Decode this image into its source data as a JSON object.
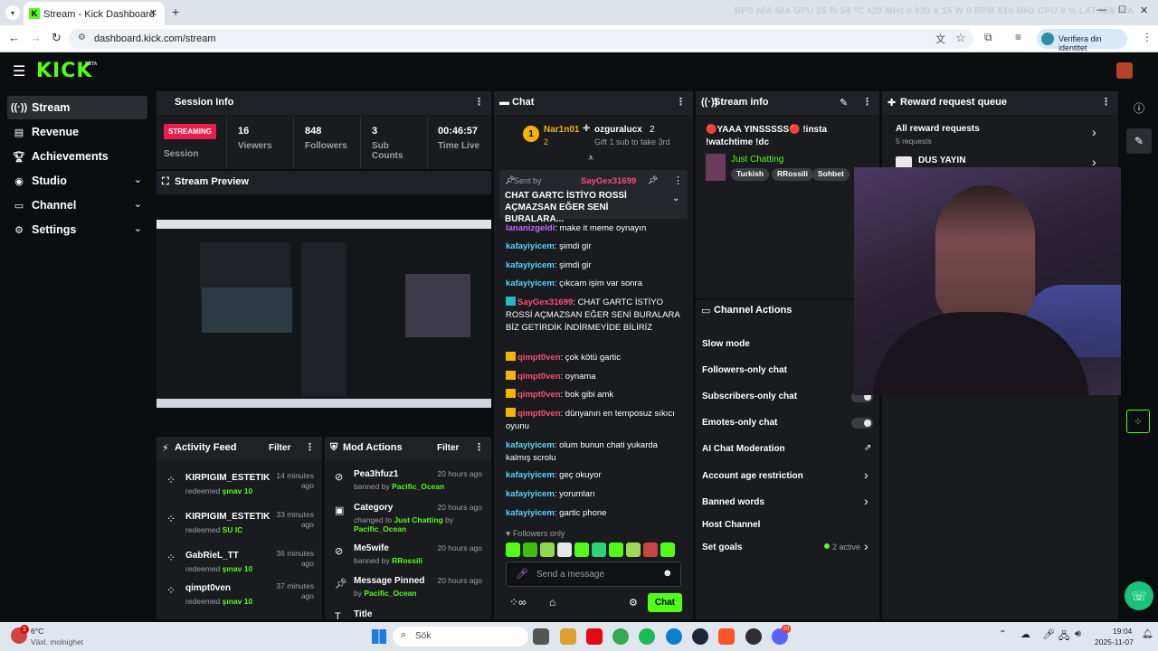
{
  "browser": {
    "tab_title": "Stream - Kick Dashboard",
    "url": "dashboard.kick.com/stream",
    "profile_label": "Verifiera din identitet",
    "hud": "BPS  N/A  N/A     GPU 25 % 54 °C 420 MHz 0.930 V 15 W 0 RPM 810 MHz     CPU 9 %     LAT N/A N/A"
  },
  "kick": {
    "logo": "KICK",
    "beta": "BETA"
  },
  "sidebar": {
    "items": [
      {
        "label": "Stream",
        "active": true
      },
      {
        "label": "Revenue"
      },
      {
        "label": "Achievements"
      },
      {
        "label": "Studio"
      },
      {
        "label": "Channel"
      },
      {
        "label": "Settings"
      }
    ]
  },
  "session": {
    "title": "Session Info",
    "status": "STREAMING",
    "status_label": "Session",
    "stats": [
      {
        "value": "16",
        "label": "Viewers"
      },
      {
        "value": "848",
        "label": "Followers"
      },
      {
        "value": "3",
        "label": "Sub Counts"
      },
      {
        "value": "00:46:57",
        "label": "Time Live"
      }
    ]
  },
  "preview": {
    "title": "Stream Preview"
  },
  "activity": {
    "title": "Activity Feed",
    "filter": "Filter",
    "items": [
      {
        "user": "KIRPIGIM_ESTETIK",
        "time": "14 minutes ago",
        "action": "redeemed",
        "reward": "şınav 10"
      },
      {
        "user": "KIRPIGIM_ESTETIK",
        "time": "33 minutes ago",
        "action": "redeemed",
        "reward": "SU IC"
      },
      {
        "user": "GabRieL_TT",
        "time": "36 minutes ago",
        "action": "redeemed",
        "reward": "şınav 10"
      },
      {
        "user": "qimpt0ven",
        "time": "37 minutes ago",
        "action": "redeemed",
        "reward": "şınav 10"
      }
    ]
  },
  "mod": {
    "title": "Mod Actions",
    "filter": "Filter",
    "items": [
      {
        "title": "Pea3hfuz1",
        "time": "20 hours ago",
        "line1": "banned by",
        "by": "Pacific_Ocean",
        "line2": ""
      },
      {
        "title": "Category",
        "time": "20 hours ago",
        "line1": "changed to",
        "by": "Just Chatting",
        "line2": "by",
        "by2": "Pacific_Ocean"
      },
      {
        "title": "Me5wife",
        "time": "20 hours ago",
        "line1": "banned by",
        "by": "RRossili",
        "line2": ""
      },
      {
        "title": "Message Pinned",
        "time": "20 hours ago",
        "line1": "by",
        "by": "Pacific_Ocean",
        "line2": ""
      },
      {
        "title": "Title",
        "time": "",
        "line1": "",
        "by": "",
        "line2": ""
      }
    ]
  },
  "chat": {
    "title": "Chat",
    "top": [
      {
        "name": "Nar1n01",
        "count": "2",
        "rank": "1"
      },
      {
        "name": "ozguralucx",
        "count": "2",
        "note": "Gift 1 sub to take 3rd"
      }
    ],
    "pinned": {
      "sent_by": "Sent by",
      "user": "SayGex31699",
      "text": "CHAT GARTC İSTİYO ROSSİ AÇMAZSAN EĞER SENİ BURALARA..."
    },
    "messages": [
      {
        "user": "lananizgeldi",
        "text": "make it meme oynayın",
        "cls": "uname3"
      },
      {
        "user": "kafayiyicem",
        "text": "şimdi gir",
        "cls": "uname"
      },
      {
        "user": "kafayiyicem",
        "text": "şimdi gir",
        "cls": "uname"
      },
      {
        "user": "kafayiyicem",
        "text": "çıkcam işim var sonra",
        "cls": "uname"
      },
      {
        "user": "SayGex31699",
        "text": "CHAT GARTC İSTİYO ROSSİ AÇMAZSAN EĞER SENİ BURALARA BİZ GETİRDİK İNDİRMEYİDE BİLİRİZ",
        "cls": "uname2"
      },
      {
        "user": "qimpt0ven",
        "text": "çok kötü gartic",
        "cls": "uname2"
      },
      {
        "user": "qimpt0ven",
        "text": "oynama",
        "cls": "uname2"
      },
      {
        "user": "qimpt0ven",
        "text": "bok gibi amk",
        "cls": "uname2"
      },
      {
        "user": "qimpt0ven",
        "text": "dünyanın en temposuz sıkıcı oyunu",
        "cls": "uname2"
      },
      {
        "user": "kafayiyicem",
        "text": "olum bunun chati yukarda kalmış scrolu",
        "cls": "uname"
      },
      {
        "user": "kafayiyicem",
        "text": "geç okuyor",
        "cls": "uname"
      },
      {
        "user": "kafayiyicem",
        "text": "yorumları",
        "cls": "uname"
      },
      {
        "user": "kafayiyicem",
        "text": "gartic phone",
        "cls": "uname"
      }
    ],
    "followers_only": "Followers only",
    "placeholder": "Send a message",
    "send": "Chat"
  },
  "streaminfo": {
    "title": "Stream info",
    "text": "🔴YAAA YINSSSSS🔴 !insta !watchtime !dc",
    "category": "Just Chatting",
    "tags": [
      "Turkish",
      "RRossili",
      "Sohbet"
    ]
  },
  "actions": {
    "title": "Channel Actions",
    "items": [
      {
        "label": "Slow mode"
      },
      {
        "label": "Followers-only chat"
      },
      {
        "label": "Subscribers-only chat"
      },
      {
        "label": "Emotes-only chat"
      },
      {
        "label": "AI Chat Moderation"
      },
      {
        "label": "Account age restriction"
      },
      {
        "label": "Banned words"
      },
      {
        "label": "Host Channel"
      },
      {
        "label": "Set goals",
        "status": "2 active"
      }
    ]
  },
  "reward": {
    "title": "Reward request queue",
    "all": "All reward requests",
    "count": "5 requests",
    "item": "DUS YAYIN"
  },
  "taskbar": {
    "temp": "6°C",
    "weather": "Växl. molnighet",
    "search": "Sök",
    "time": "19:04",
    "date": "2025-11-07",
    "notif": "1",
    "badge": "20"
  },
  "colors": {
    "accent": "#53fc18",
    "panel": "#191b1f",
    "streaming": "#e91e4f"
  }
}
